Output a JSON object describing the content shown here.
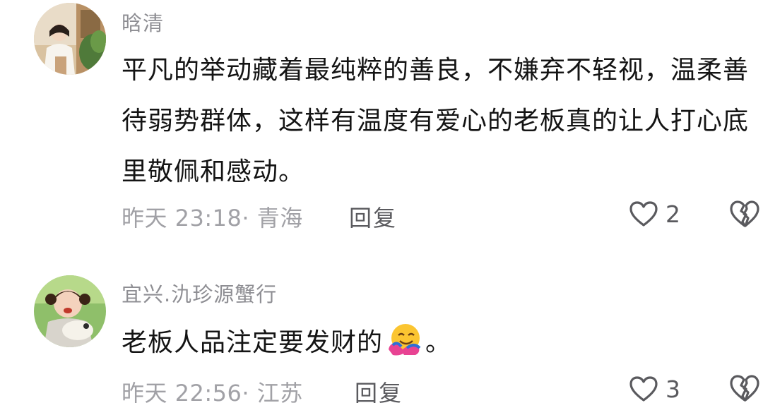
{
  "comments": [
    {
      "username": "晗清",
      "text": "平凡的举动藏着最纯粹的善良，不嫌弃不轻视，温柔善待弱势群体，这样有温度有爱心的老板真的让人打心底里敬佩和感动。",
      "time_location": "昨天 23:18· 青海",
      "reply_label": "回复",
      "likes": "2"
    },
    {
      "username": "宜兴.氿珍源蟹行",
      "text_before_emoji": "老板人品注定要发财的",
      "text_after_emoji": "。",
      "emoji": "hugging-face-emoji",
      "time_location": "昨天 22:56· 江苏",
      "reply_label": "回复",
      "likes": "3"
    }
  ],
  "icons": {
    "like": "heart-outline-icon",
    "dislike": "broken-heart-icon"
  },
  "colors": {
    "username": "#8e8e93",
    "meta": "#a1a1a6",
    "icon": "#5a5a5e"
  }
}
